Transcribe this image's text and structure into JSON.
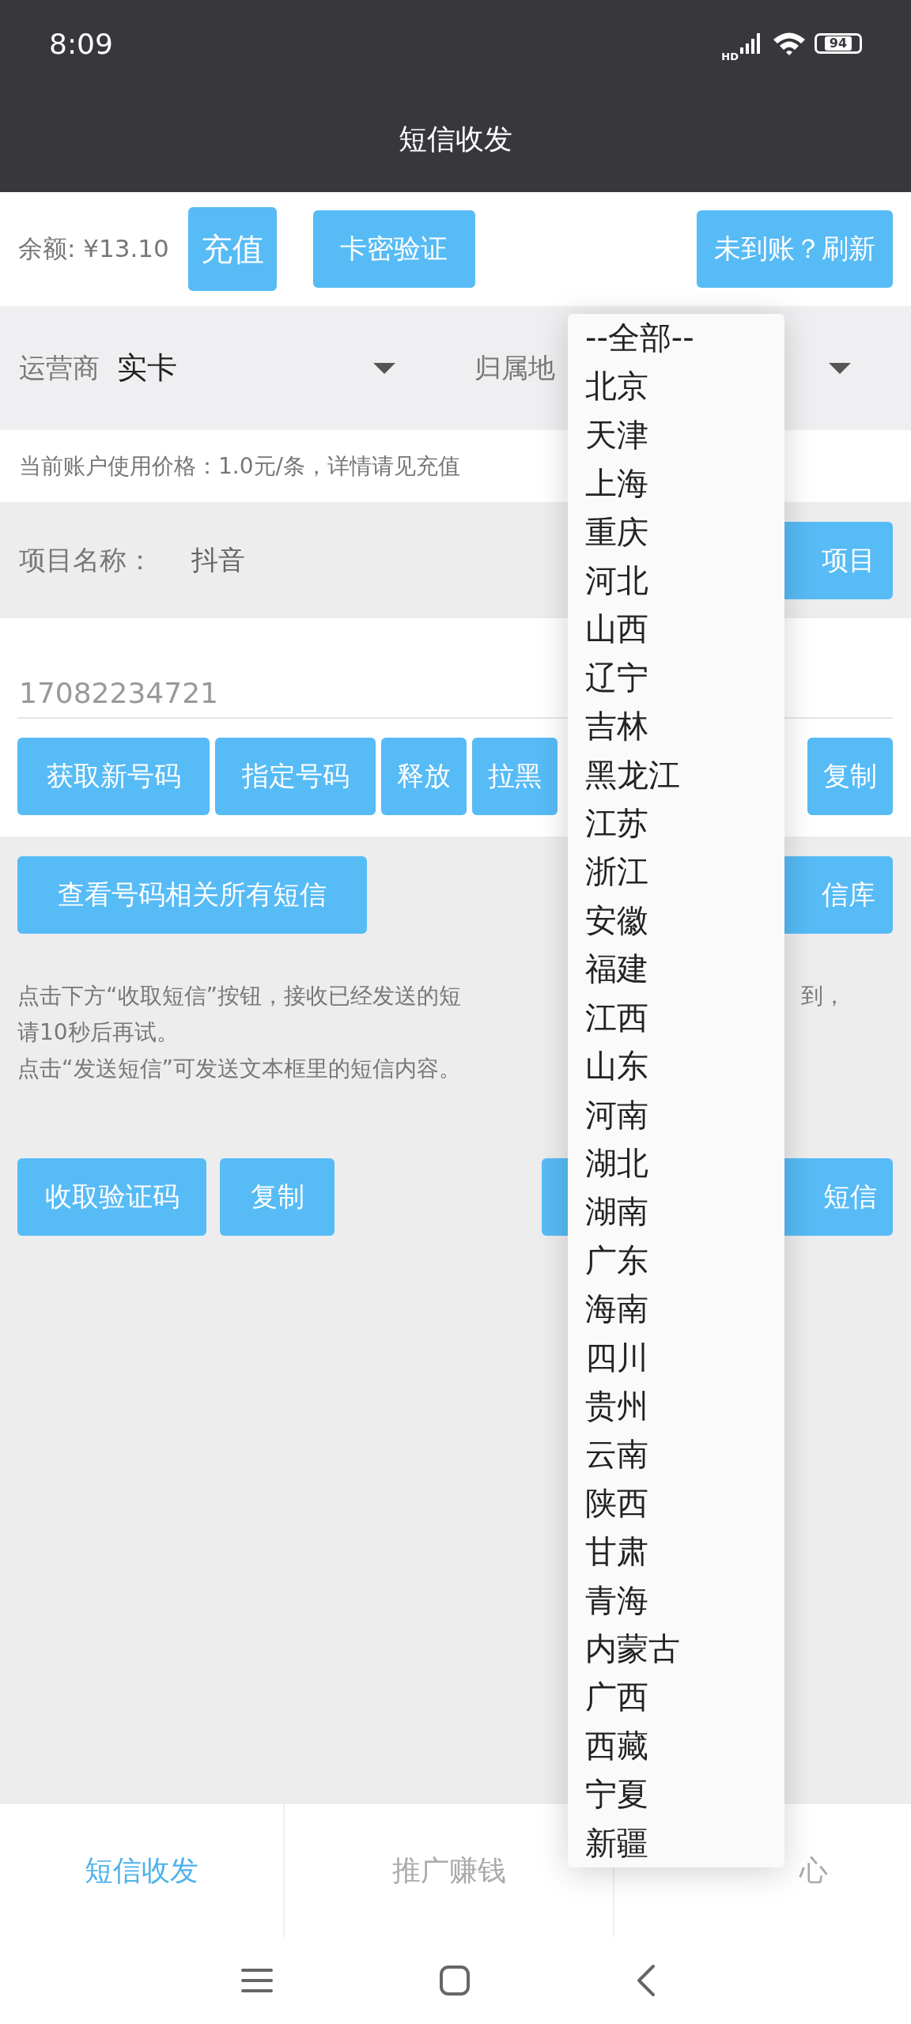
{
  "status_bar": {
    "time": "8:09",
    "network": "HD",
    "battery": "94"
  },
  "header": {
    "title": "短信收发"
  },
  "balance": {
    "label": "余额: ¥13.10",
    "recharge_button": "充值",
    "card_button": "卡密验证",
    "refresh_button": "未到账？刷新"
  },
  "filters": [
    {
      "label": "运营商",
      "value": "实卡"
    },
    {
      "label": "归属地"
    }
  ],
  "price_note": "当前账户使用价格：1.0元/条，详情请见充值",
  "project": {
    "label": "项目名称：",
    "value": "抖音",
    "button": "项目"
  },
  "phone": {
    "value": "17082234721"
  },
  "number_buttons_left": [
    "获取新号码",
    "指定号码",
    "释放",
    "拉黑"
  ],
  "number_buttons_right": [
    "复制"
  ],
  "messages": {
    "view_all_button": "查看号码相关所有短信",
    "library_button": "信库"
  },
  "instructions": [
    {
      "text": "点击下方“收取短信”按钮，接收已经发送的短",
      "tail": "到，"
    },
    {
      "text": "请10秒后再试。"
    },
    {
      "text": "点击“发送短信”可发送文本框里的短信内容。"
    }
  ],
  "code_buttons": [
    "收取验证码",
    "复制"
  ],
  "send_button": "短信",
  "tabs": [
    {
      "label": "短信收发",
      "selected": true
    },
    {
      "label": "推广赚钱",
      "selected": false
    },
    {
      "label": "心",
      "selected": false
    }
  ],
  "region_dropdown": {
    "options": [
      "--全部--",
      "北京",
      "天津",
      "上海",
      "重庆",
      "河北",
      "山西",
      "辽宁",
      "吉林",
      "黑龙江",
      "江苏",
      "浙江",
      "安徽",
      "福建",
      "江西",
      "山东",
      "河南",
      "湖北",
      "湖南",
      "广东",
      "海南",
      "四川",
      "贵州",
      "云南",
      "陕西",
      "甘肃",
      "青海",
      "内蒙古",
      "广西",
      "西藏",
      "宁夏",
      "新疆"
    ]
  }
}
